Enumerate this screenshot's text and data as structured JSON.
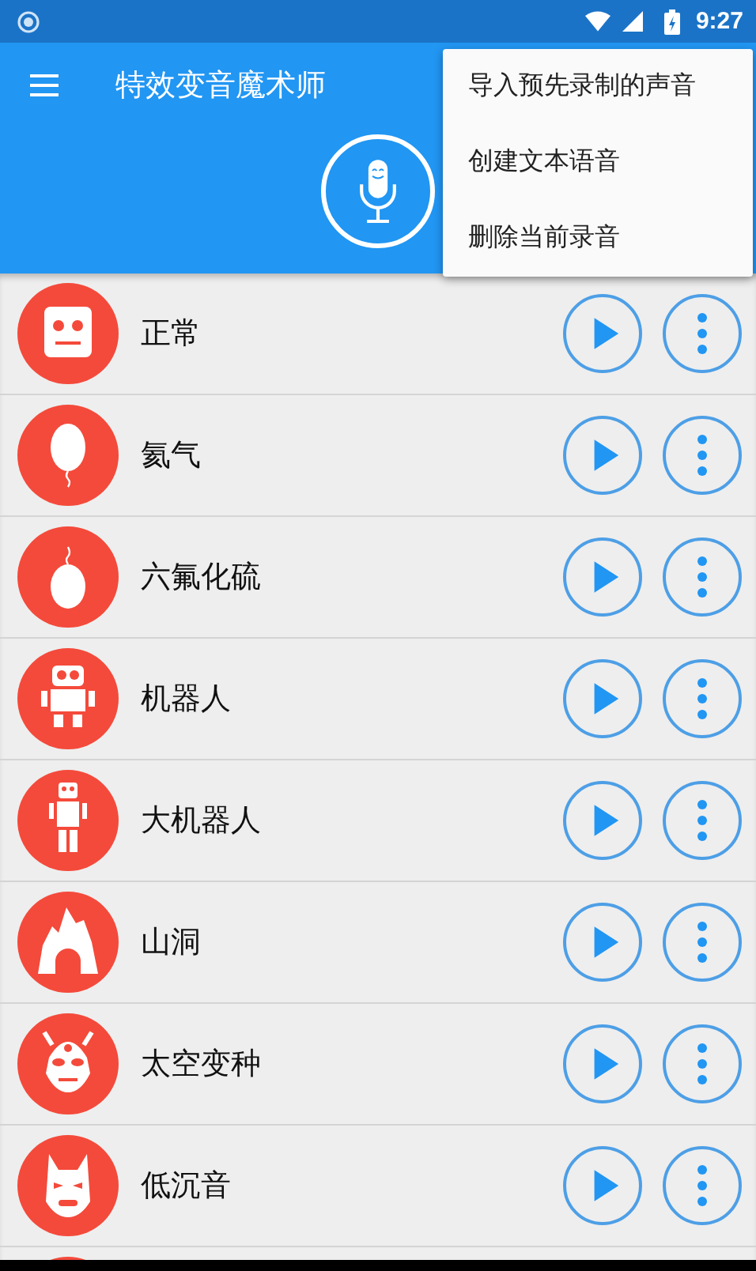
{
  "status_bar": {
    "time": "9:27"
  },
  "app_bar": {
    "title": "特效变音魔术师"
  },
  "menu": {
    "items": [
      {
        "label": "导入预先录制的声音"
      },
      {
        "label": "创建文本语音"
      },
      {
        "label": "删除当前录音"
      }
    ]
  },
  "effects": [
    {
      "kind": "face",
      "label": "正常"
    },
    {
      "kind": "balloon",
      "label": "氦气"
    },
    {
      "kind": "weight",
      "label": "六氟化硫"
    },
    {
      "kind": "robot",
      "label": "机器人"
    },
    {
      "kind": "tallrobot",
      "label": "大机器人"
    },
    {
      "kind": "cave",
      "label": "山洞"
    },
    {
      "kind": "alien",
      "label": "太空变种"
    },
    {
      "kind": "mask",
      "label": "低沉音"
    },
    {
      "kind": "blank"
    }
  ]
}
